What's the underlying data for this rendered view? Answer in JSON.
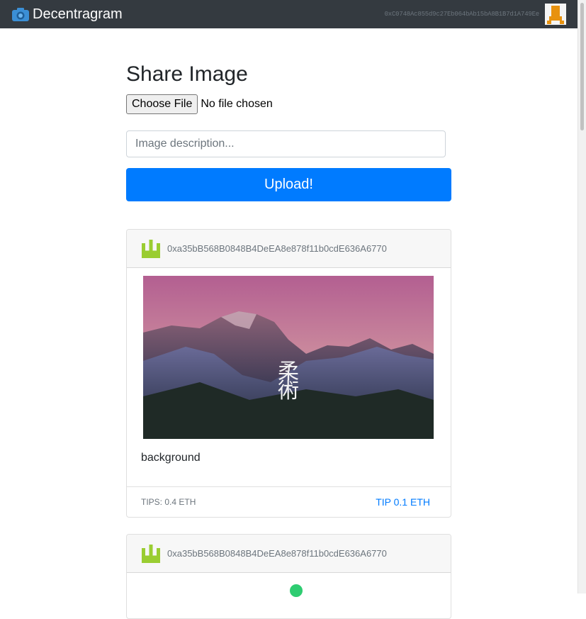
{
  "navbar": {
    "brand": "Decentragram",
    "brand_icon": "camera-icon",
    "account": "0xC0748Ac855d9c27Eb064bAb15bA8B1B7d1A749Ee",
    "account_avatar": "identicon-avatar"
  },
  "form": {
    "title": "Share Image",
    "file_button": "Choose File",
    "file_status": "No file chosen",
    "description_placeholder": "Image description...",
    "upload_label": "Upload!"
  },
  "posts": [
    {
      "author": "0xa35bB568B0848B4DeEA8e878f11b0cdE636A6770",
      "caption": "background",
      "tips": "TIPS: 0.4 ETH",
      "tip_action": "TIP 0.1 ETH"
    },
    {
      "author": "0xa35bB568B0848B4DeEA8e878f11b0cdE636A6770"
    }
  ],
  "colors": {
    "navbar": "#343a40",
    "primary": "#007bff",
    "identicon": "#9acd32"
  }
}
